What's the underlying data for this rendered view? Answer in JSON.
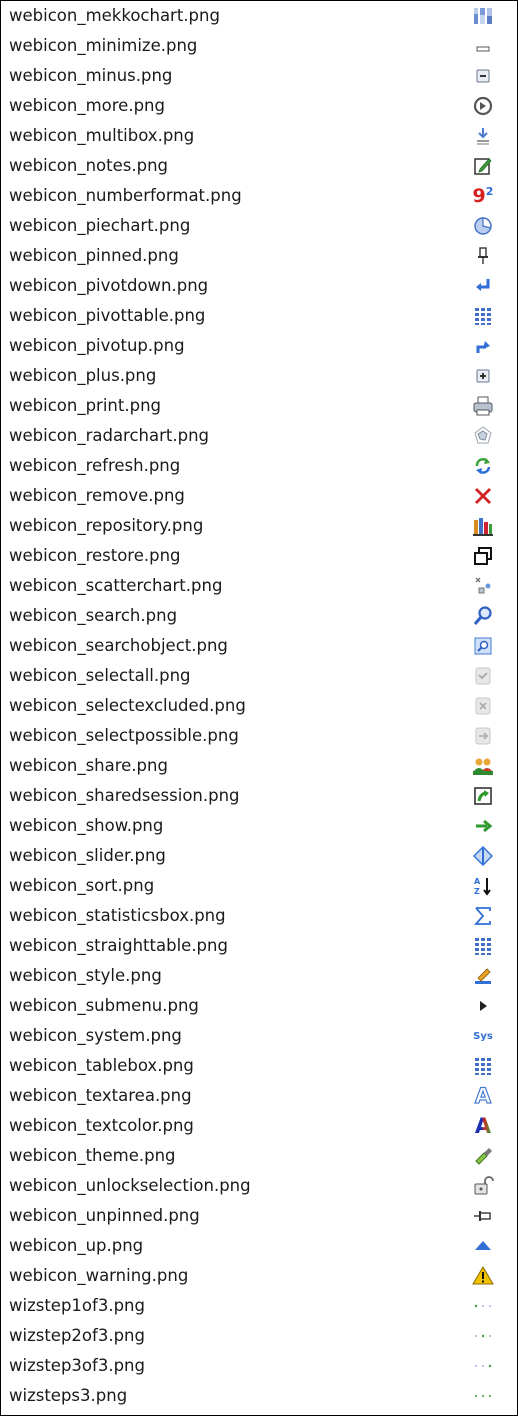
{
  "rows": [
    {
      "label": "webicon_mekkochart.png",
      "icon": "mekko-chart-icon"
    },
    {
      "label": "webicon_minimize.png",
      "icon": "minimize-icon"
    },
    {
      "label": "webicon_minus.png",
      "icon": "minus-icon"
    },
    {
      "label": "webicon_more.png",
      "icon": "more-icon"
    },
    {
      "label": "webicon_multibox.png",
      "icon": "multibox-icon"
    },
    {
      "label": "webicon_notes.png",
      "icon": "notes-icon"
    },
    {
      "label": "webicon_numberformat.png",
      "icon": "number-format-icon"
    },
    {
      "label": "webicon_piechart.png",
      "icon": "pie-chart-icon"
    },
    {
      "label": "webicon_pinned.png",
      "icon": "pinned-icon"
    },
    {
      "label": "webicon_pivotdown.png",
      "icon": "pivot-down-icon"
    },
    {
      "label": "webicon_pivottable.png",
      "icon": "pivot-table-icon"
    },
    {
      "label": "webicon_pivotup.png",
      "icon": "pivot-up-icon"
    },
    {
      "label": "webicon_plus.png",
      "icon": "plus-icon"
    },
    {
      "label": "webicon_print.png",
      "icon": "print-icon"
    },
    {
      "label": "webicon_radarchart.png",
      "icon": "radar-chart-icon"
    },
    {
      "label": "webicon_refresh.png",
      "icon": "refresh-icon"
    },
    {
      "label": "webicon_remove.png",
      "icon": "remove-icon"
    },
    {
      "label": "webicon_repository.png",
      "icon": "repository-icon"
    },
    {
      "label": "webicon_restore.png",
      "icon": "restore-icon"
    },
    {
      "label": "webicon_scatterchart.png",
      "icon": "scatter-chart-icon"
    },
    {
      "label": "webicon_search.png",
      "icon": "search-icon"
    },
    {
      "label": "webicon_searchobject.png",
      "icon": "search-object-icon"
    },
    {
      "label": "webicon_selectall.png",
      "icon": "select-all-icon"
    },
    {
      "label": "webicon_selectexcluded.png",
      "icon": "select-excluded-icon"
    },
    {
      "label": "webicon_selectpossible.png",
      "icon": "select-possible-icon"
    },
    {
      "label": "webicon_share.png",
      "icon": "share-icon"
    },
    {
      "label": "webicon_sharedsession.png",
      "icon": "shared-session-icon"
    },
    {
      "label": "webicon_show.png",
      "icon": "show-icon"
    },
    {
      "label": "webicon_slider.png",
      "icon": "slider-icon"
    },
    {
      "label": "webicon_sort.png",
      "icon": "sort-icon"
    },
    {
      "label": "webicon_statisticsbox.png",
      "icon": "statistics-box-icon"
    },
    {
      "label": "webicon_straighttable.png",
      "icon": "straight-table-icon"
    },
    {
      "label": "webicon_style.png",
      "icon": "style-icon"
    },
    {
      "label": "webicon_submenu.png",
      "icon": "submenu-icon"
    },
    {
      "label": "webicon_system.png",
      "icon": "system-icon",
      "icon_text": "Sys"
    },
    {
      "label": "webicon_tablebox.png",
      "icon": "table-box-icon"
    },
    {
      "label": "webicon_textarea.png",
      "icon": "text-area-icon",
      "icon_text": "A"
    },
    {
      "label": "webicon_textcolor.png",
      "icon": "text-color-icon",
      "icon_text": "A"
    },
    {
      "label": "webicon_theme.png",
      "icon": "theme-icon"
    },
    {
      "label": "webicon_unlockselection.png",
      "icon": "unlock-selection-icon"
    },
    {
      "label": "webicon_unpinned.png",
      "icon": "unpinned-icon"
    },
    {
      "label": "webicon_up.png",
      "icon": "up-icon"
    },
    {
      "label": "webicon_warning.png",
      "icon": "warning-icon"
    },
    {
      "label": "wizstep1of3.png",
      "icon": "wizard-step-1-of-3-icon"
    },
    {
      "label": "wizstep2of3.png",
      "icon": "wizard-step-2-of-3-icon"
    },
    {
      "label": "wizstep3of3.png",
      "icon": "wizard-step-3-of-3-icon"
    },
    {
      "label": "wizsteps3.png",
      "icon": "wizard-steps-3-icon"
    }
  ],
  "number_format_icon": {
    "digit": "9",
    "exponent": "2"
  },
  "colors": {
    "text": "#1a1a1a",
    "border": "#000000",
    "accent_blue": "#2f6fd6",
    "remove_red": "#d42020",
    "refresh_green": "#3aa23a",
    "warning_yellow": "#f2c200"
  }
}
